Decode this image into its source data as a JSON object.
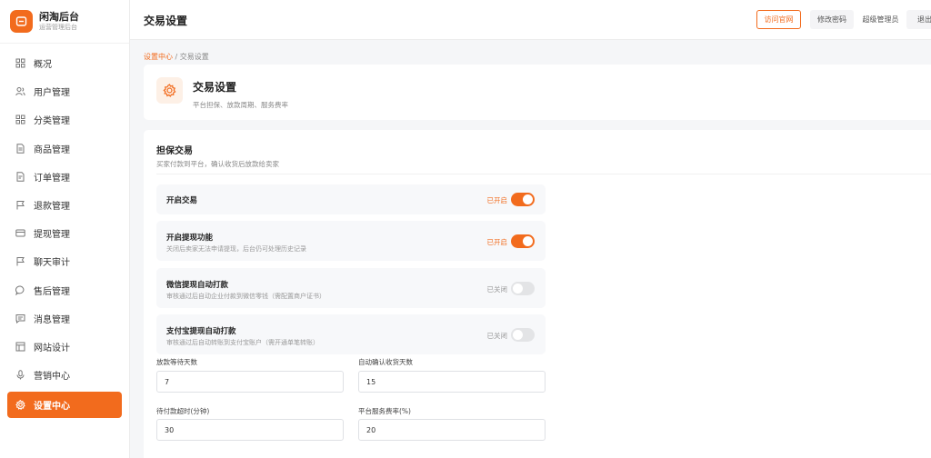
{
  "brand": {
    "title": "闲淘后台",
    "subtitle": "运营管理后台"
  },
  "sidebar": {
    "items": [
      {
        "label": "概况",
        "icon": "grid-icon",
        "active": false
      },
      {
        "label": "用户管理",
        "icon": "users-icon",
        "active": false
      },
      {
        "label": "分类管理",
        "icon": "category-icon",
        "active": false
      },
      {
        "label": "商品管理",
        "icon": "document-icon",
        "active": false
      },
      {
        "label": "订单管理",
        "icon": "order-icon",
        "active": false
      },
      {
        "label": "退款管理",
        "icon": "flag-icon",
        "active": false
      },
      {
        "label": "提现管理",
        "icon": "card-icon",
        "active": false
      },
      {
        "label": "聊天审计",
        "icon": "flag-icon",
        "active": false
      },
      {
        "label": "售后管理",
        "icon": "chat-icon",
        "active": false
      },
      {
        "label": "消息管理",
        "icon": "message-icon",
        "active": false
      },
      {
        "label": "网站设计",
        "icon": "layout-icon",
        "active": false
      },
      {
        "label": "营销中心",
        "icon": "mic-icon",
        "active": false
      },
      {
        "label": "设置中心",
        "icon": "gear-icon",
        "active": true
      }
    ]
  },
  "topbar": {
    "title": "交易设置",
    "visit_label": "访问官网",
    "change_password_label": "修改密码",
    "user_label": "超级管理员",
    "logout_label": "退出"
  },
  "breadcrumb": {
    "parent": "设置中心",
    "separator": " / ",
    "current": "交易设置"
  },
  "header_card": {
    "title": "交易设置",
    "subtitle": "平台担保、放款周期、服务费率"
  },
  "section": {
    "title": "担保交易",
    "subtitle": "买家付款到平台，确认收货后放款给卖家"
  },
  "toggles": [
    {
      "label": "开启交易",
      "desc": "",
      "status": "已开启",
      "on": true
    },
    {
      "label": "开启提现功能",
      "desc": "关闭后卖家无法申请提现，后台仍可处理历史记录",
      "status": "已开启",
      "on": true
    },
    {
      "label": "微信提现自动打款",
      "desc": "审核通过后自动企业付款到微信零钱（需配置商户证书）",
      "status": "已关闭",
      "on": false
    },
    {
      "label": "支付宝提现自动打款",
      "desc": "审核通过后自动转账到支付宝账户（需开通单笔转账）",
      "status": "已关闭",
      "on": false
    }
  ],
  "fields": [
    {
      "label": "放款等待天数",
      "value": "7"
    },
    {
      "label": "自动确认收货天数",
      "value": "15"
    },
    {
      "label": "待付款超时(分钟)",
      "value": "30"
    },
    {
      "label": "平台服务费率(%)",
      "value": "20"
    }
  ],
  "colors": {
    "accent": "#f26b1d",
    "background": "#f5f6f8"
  }
}
